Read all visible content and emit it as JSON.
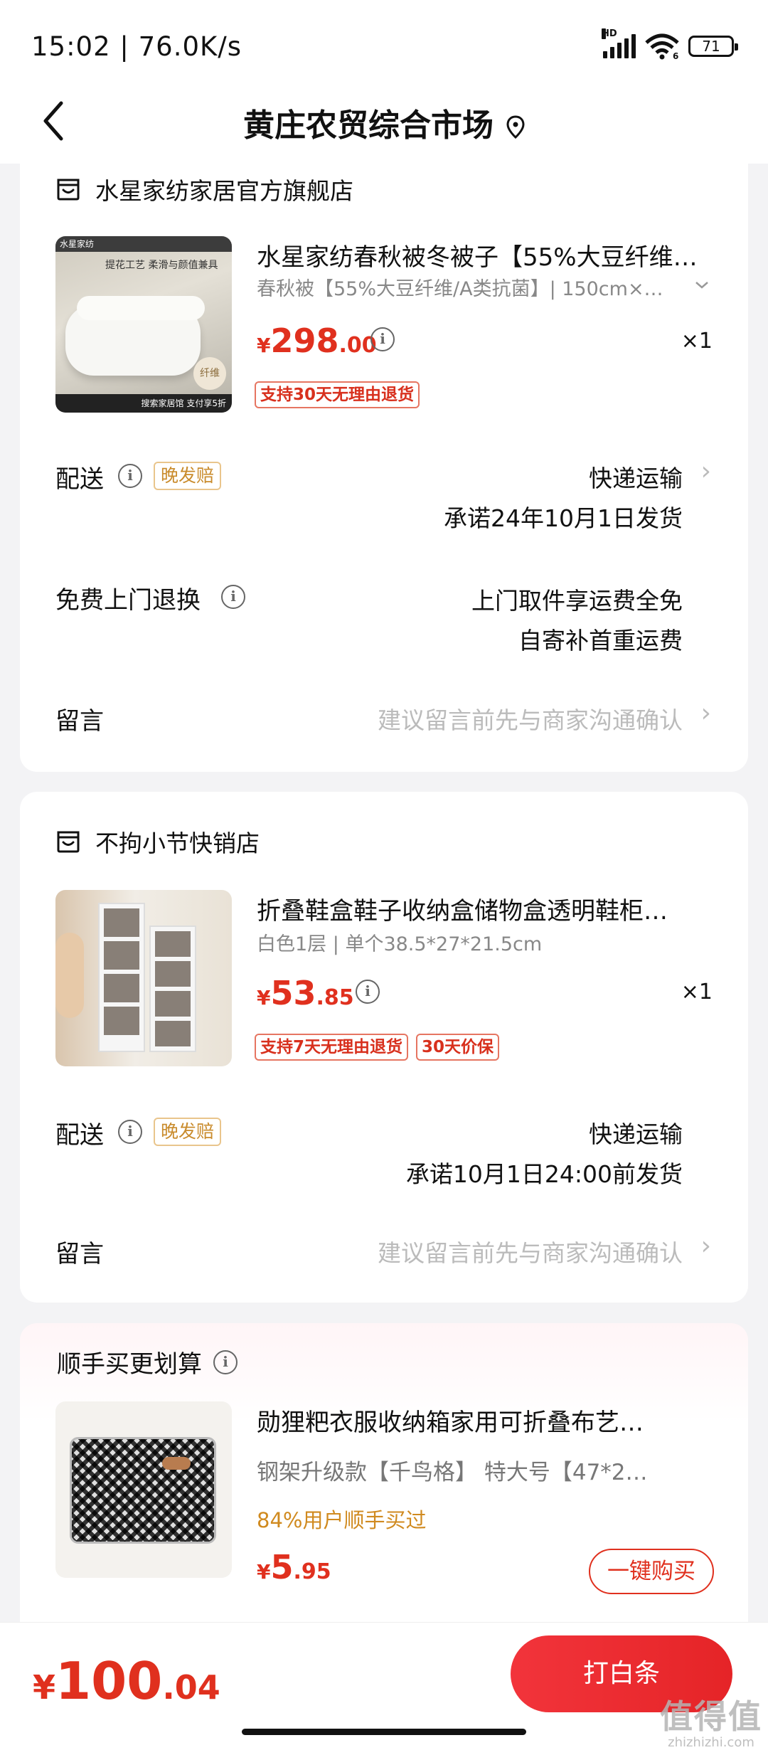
{
  "status_bar": {
    "time": "15:02 | 76.0K/s",
    "network": "HD",
    "wifi_label": "6",
    "battery": "71"
  },
  "nav": {
    "title": "黄庄农贸综合市场"
  },
  "stores": [
    {
      "name": "水星家纺家居官方旗舰店",
      "product": {
        "title": "水星家纺春秋被冬被子【55%大豆纤维…",
        "spec": "春秋被【55%大豆纤维/A类抗菌】| 150cm×…",
        "price_currency": "¥",
        "price_int": "298",
        "price_dec": ".00",
        "qty": "×1",
        "tags": [
          "支持30天无理由退货"
        ],
        "thumb_text": {
          "brand": "水星家纺",
          "headline": "提花工艺 柔滑与颜值兼具",
          "badge": "纤维",
          "banner": "搜索家居馆 支付享5折"
        }
      },
      "delivery": {
        "label": "配送",
        "tag": "晚发赔",
        "method": "快递运输",
        "promise": "承诺24年10月1日发货"
      },
      "return_service": {
        "label": "免费上门退换",
        "line1": "上门取件享运费全免",
        "line2": "自寄补首重运费"
      },
      "message": {
        "label": "留言",
        "placeholder": "建议留言前先与商家沟通确认"
      }
    },
    {
      "name": "不拘小节快销店",
      "product": {
        "title": "折叠鞋盒鞋子收纳盒储物盒透明鞋柜…",
        "spec": "白色1层 | 单个38.5*27*21.5cm",
        "price_currency": "¥",
        "price_int": "53",
        "price_dec": ".85",
        "qty": "×1",
        "tags": [
          "支持7天无理由退货",
          "30天价保"
        ]
      },
      "delivery": {
        "label": "配送",
        "tag": "晚发赔",
        "method": "快递运输",
        "promise": "承诺10月1日24:00前发货"
      },
      "message": {
        "label": "留言",
        "placeholder": "建议留言前先与商家沟通确认"
      }
    }
  ],
  "upsell": {
    "title": "顺手买更划算",
    "product": {
      "title": "勋狸粑衣服收纳箱家用可折叠布艺…",
      "spec": "钢架升级款【千鸟格】  特大号【47*2…",
      "social_proof": "84%用户顺手买过",
      "price_currency": "¥",
      "price_int": "5",
      "price_dec": ".95",
      "buy_label": "一键购买"
    }
  },
  "bottom": {
    "total_currency": "¥",
    "total_int": "100",
    "total_dec": ".04",
    "pay_label": "打白条"
  },
  "watermark": {
    "logo": "值得值",
    "url": "zhizhizhi.com"
  },
  "colors": {
    "accent": "#e0301e",
    "gold": "#c98b2c",
    "background": "#f3f3f5"
  }
}
